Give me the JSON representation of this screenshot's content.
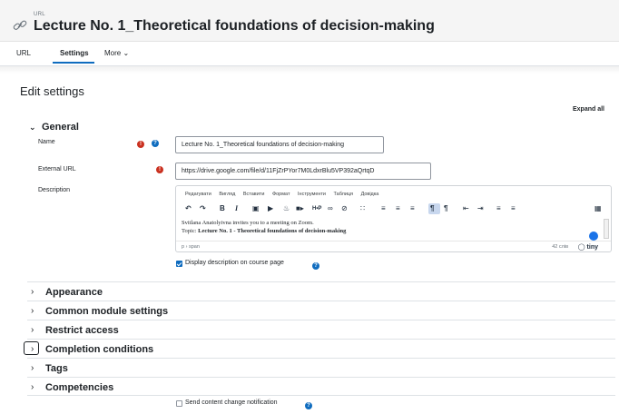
{
  "header": {
    "type_label": "URL",
    "title": "Lecture No. 1_Theoretical foundations of decision-making"
  },
  "tabs": [
    {
      "label": "URL"
    },
    {
      "label": "Settings"
    },
    {
      "label": "More ⌄"
    }
  ],
  "page": {
    "heading": "Edit settings",
    "expand_all": "Expand all"
  },
  "general": {
    "section_label": "General",
    "name_label": "Name",
    "name_value": "Lecture No. 1_Theoretical foundations of decision-making",
    "url_label": "External URL",
    "url_value": "https://drive.google.com/file/d/11FjZrPYor7M0LdxrBlu5VP392aQrtqD",
    "description_label": "Description",
    "display_description_label": "Display description on course page"
  },
  "editor": {
    "menu": [
      "Редагувати",
      "Вигляд",
      "Вставити",
      "Формат",
      "Інструменти",
      "Таблиця",
      "Довідка"
    ],
    "content_line1": "Svitlana Anatolyivna invites you to a meeting on Zoom.",
    "content_line2_prefix": "Topic: ",
    "content_line2_bold": "Lecture No. 1 - Theoretical foundations of decision-making",
    "status_path": "p › span",
    "word_count": "42 слів",
    "brand": "tiny"
  },
  "sections": [
    {
      "label": "Appearance"
    },
    {
      "label": "Common module settings"
    },
    {
      "label": "Restrict access"
    },
    {
      "label": "Completion conditions"
    },
    {
      "label": "Tags"
    },
    {
      "label": "Competencies"
    }
  ],
  "notification": {
    "label": "Send content change notification"
  },
  "colors": {
    "accent": "#0f6cbf",
    "required": "#ca3120",
    "header_bg": "#f5f5f5"
  }
}
